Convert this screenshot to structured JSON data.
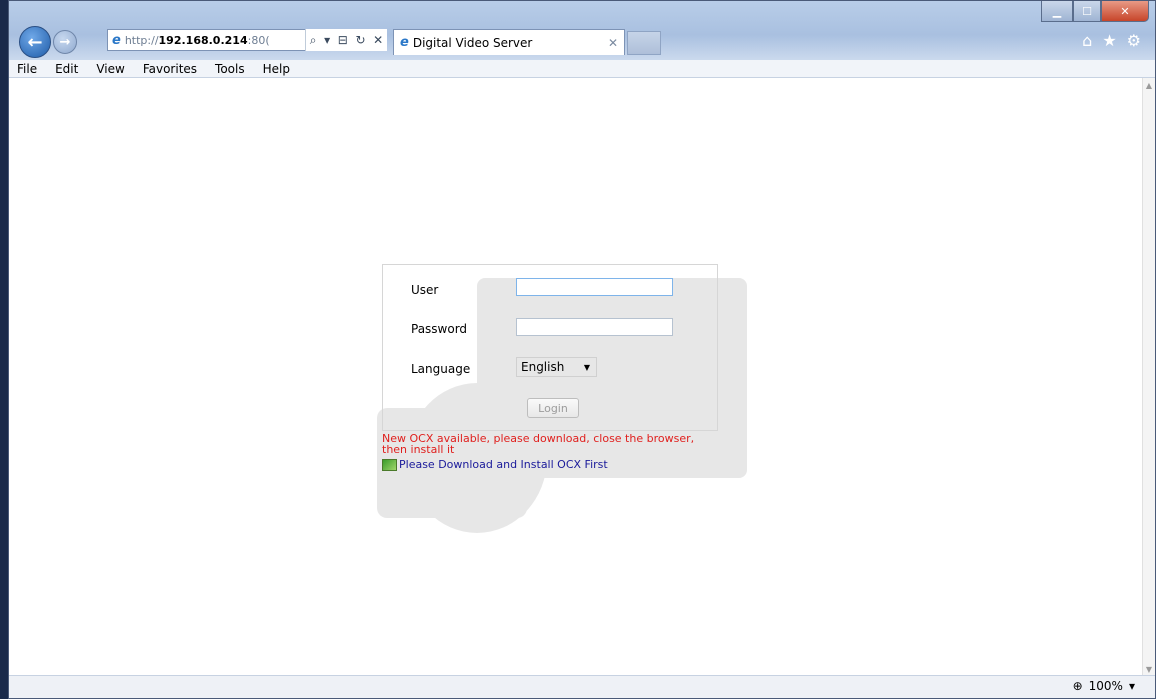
{
  "browser": {
    "address_protocol": "http://",
    "address_host": "192.168.0.214",
    "address_suffix": ":80(",
    "tab_title": "Digital Video Server",
    "menu": [
      "File",
      "Edit",
      "View",
      "Favorites",
      "Tools",
      "Help"
    ],
    "zoom_level": "100%"
  },
  "login": {
    "user_label": "User",
    "user_value": "",
    "password_label": "Password",
    "password_value": "",
    "language_label": "Language",
    "language_selected": "English",
    "login_button": "Login"
  },
  "notice": {
    "warning": "New OCX available, please download, close the browser, then install it",
    "download_link": "Please Download and Install OCX First"
  }
}
